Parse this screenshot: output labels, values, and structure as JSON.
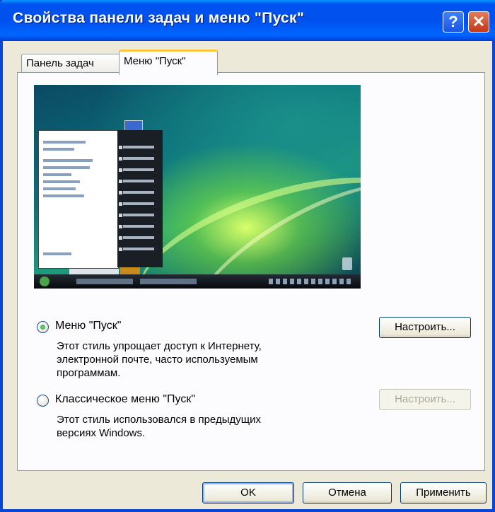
{
  "window": {
    "title": "Свойства панели задач и меню \"Пуск\"",
    "help_label": "?",
    "close_label": "✕"
  },
  "tabs": [
    {
      "label": "Панель задач",
      "active": false
    },
    {
      "label": "Меню \"Пуск\"",
      "active": true
    }
  ],
  "preview": {
    "description_icon": "windows-vista-desktop-preview"
  },
  "options": [
    {
      "label": "Меню \"Пуск\"",
      "selected": true,
      "description_lines": [
        "Этот стиль упрощает доступ к Интернету,",
        "электронной почте, часто используемым",
        "программам."
      ],
      "customize_label": "Настроить...",
      "customize_enabled": true
    },
    {
      "label": "Классическое меню \"Пуск\"",
      "selected": false,
      "description_lines": [
        "Этот стиль использовался в предыдущих",
        "версиях Windows."
      ],
      "customize_label": "Настроить...",
      "customize_enabled": false
    }
  ],
  "footer": {
    "ok_label": "OK",
    "cancel_label": "Отмена",
    "apply_label": "Применить"
  },
  "colors": {
    "titlebar": "#0050ee",
    "dialog_bg": "#ece9d8",
    "radio_selected": "#21a121"
  }
}
